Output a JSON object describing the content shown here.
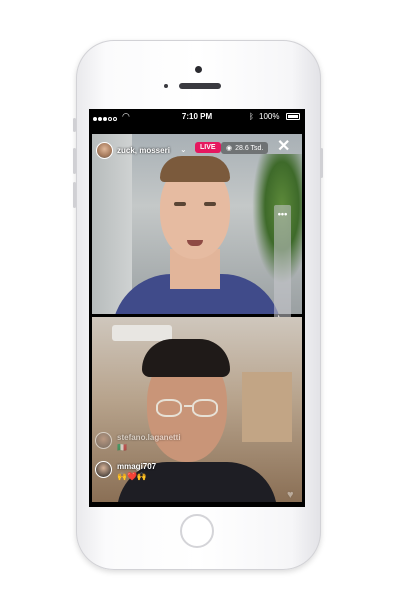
{
  "status_bar": {
    "signal_icon": "signal-dots-icon",
    "wifi_icon": "wifi-icon",
    "time": "7:10 PM",
    "bluetooth_icon": "bluetooth-icon",
    "battery_percent": "100%"
  },
  "live_header": {
    "host_name": "zuck, mosseri",
    "live_label": "LIVE",
    "viewer_count": "28.6 Tsd.",
    "close_icon": "close-icon",
    "live_color": "#e6175f"
  },
  "side_panel": {
    "more_icon": "more-dots-icon",
    "mic_icon": "microphone-icon"
  },
  "comments": [
    {
      "username": "stefano.laganetti",
      "text": "🇮🇹",
      "faded": true
    },
    {
      "username": "mmagi707",
      "text": "🙌❤️🙌",
      "faded": false
    }
  ],
  "hearts_icon": "heart-icon"
}
